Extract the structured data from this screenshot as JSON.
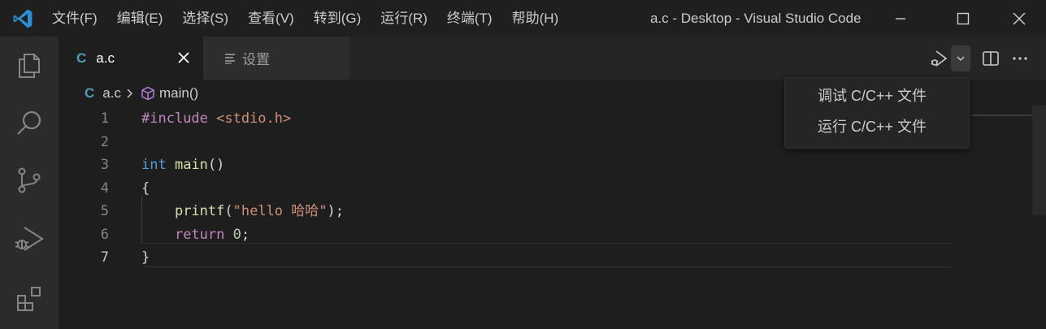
{
  "app": {
    "window_title": "a.c - Desktop - Visual Studio Code",
    "accent_color": "#0078d4",
    "logo_icon": "vscode-logo-icon"
  },
  "menu": [
    "文件(F)",
    "编辑(E)",
    "选择(S)",
    "查看(V)",
    "转到(G)",
    "运行(R)",
    "终端(T)",
    "帮助(H)"
  ],
  "window_controls": [
    "minimize-icon",
    "maximize-icon",
    "close-icon"
  ],
  "activity_bar": [
    "explorer-icon",
    "search-icon",
    "source-control-icon",
    "run-debug-icon",
    "extensions-icon"
  ],
  "tabs": [
    {
      "icon": "C",
      "label": "a.c",
      "active": true,
      "close_icon": "close-icon"
    },
    {
      "icon": "settings-list-icon",
      "label": "设置",
      "active": false
    }
  ],
  "editor_actions": [
    "run-debug-play-icon",
    "chevron-down-icon",
    "split-editor-icon",
    "more-actions-icon"
  ],
  "breadcrumb": {
    "file_icon": "C",
    "file": "a.c",
    "separator_icon": "chevron-right-icon",
    "symbol_icon": "cube-icon",
    "symbol": "main()"
  },
  "code": {
    "line_numbers": [
      "1",
      "2",
      "3",
      "4",
      "5",
      "6",
      "7"
    ],
    "current_line": "7",
    "lines": {
      "l1_directive": "#include",
      "l1_header": " <stdio.h>",
      "l3_type": "int",
      "l3_fn": " main",
      "l3_rest": "()",
      "l4": "{",
      "l5_fn": "printf",
      "l5_open": "(",
      "l5_str": "\"hello 哈哈\"",
      "l5_close": ");",
      "l6_kw": "return",
      "l6_num": " 0",
      "l6_semi": ";",
      "l7": "}"
    }
  },
  "dropdown": {
    "items": [
      "调试 C/C++ 文件",
      "运行 C/C++ 文件"
    ]
  }
}
